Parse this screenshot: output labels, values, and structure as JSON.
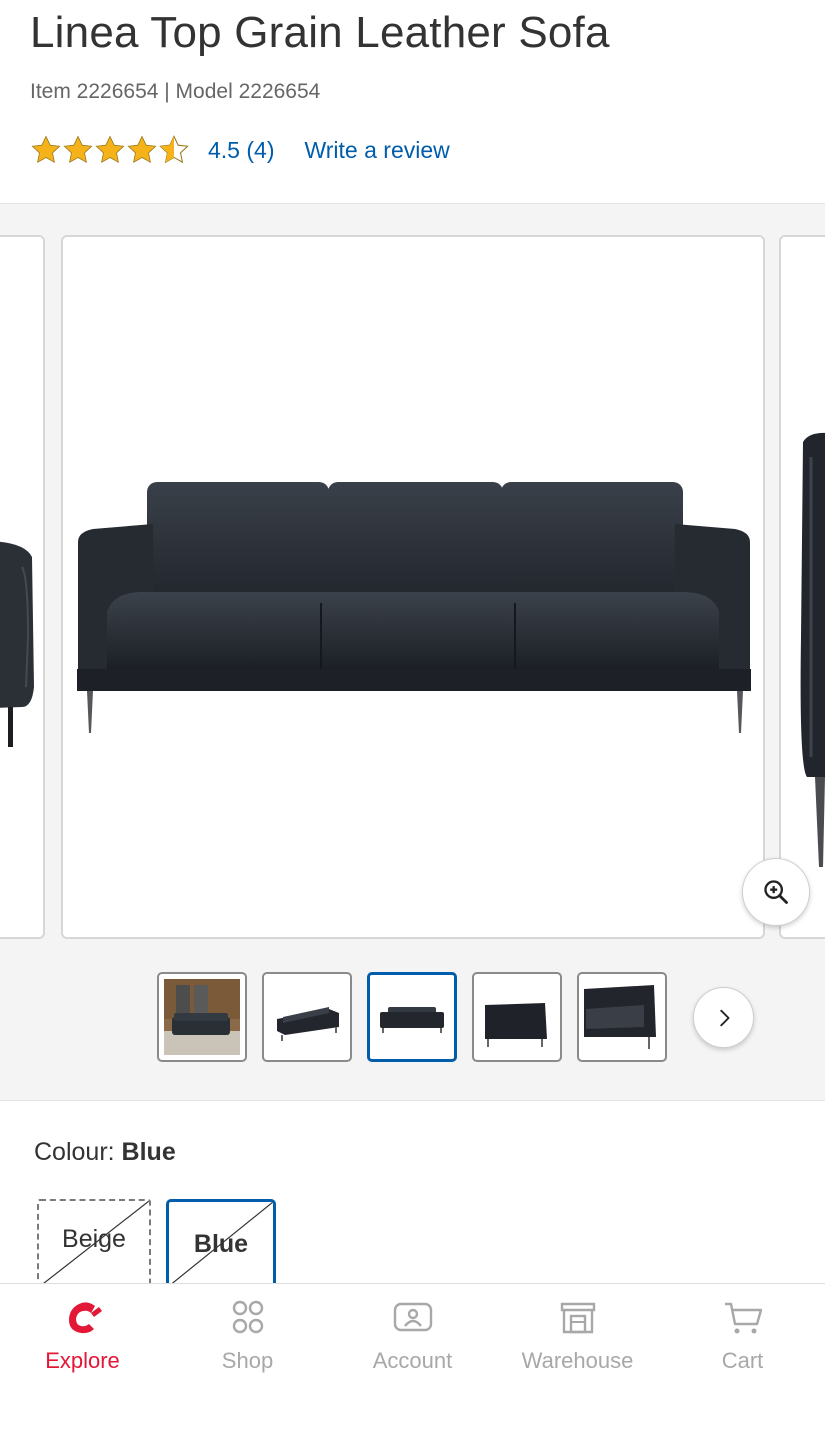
{
  "product": {
    "title": "Linea Top Grain Leather Sofa",
    "item_line": "Item 2226654 | Model 2226654",
    "rating_value": 4.5,
    "rating_text": "4.5 (4)",
    "write_review": "Write a review"
  },
  "gallery": {
    "thumbnail_count_visible": 5,
    "selected_thumbnail_index": 3
  },
  "colour": {
    "label": "Colour:",
    "selected": "Blue",
    "options": [
      "Beige",
      "Blue"
    ]
  },
  "bottom_nav": {
    "items": [
      {
        "label": "Explore",
        "icon": "explore-logo-icon",
        "active": true
      },
      {
        "label": "Shop",
        "icon": "grid-icon",
        "active": false
      },
      {
        "label": "Account",
        "icon": "account-icon",
        "active": false
      },
      {
        "label": "Warehouse",
        "icon": "warehouse-icon",
        "active": false
      },
      {
        "label": "Cart",
        "icon": "cart-icon",
        "active": false
      }
    ]
  },
  "colors": {
    "link": "#005dab",
    "active_nav": "#e31837",
    "star": "#f6b319"
  }
}
